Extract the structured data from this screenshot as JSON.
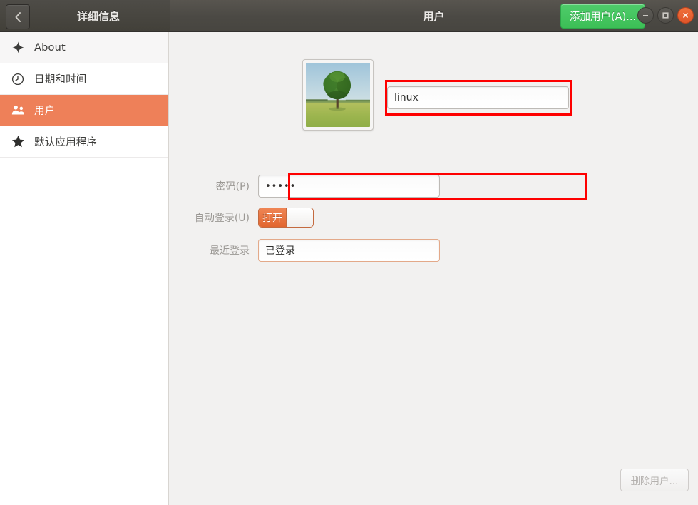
{
  "titlebar": {
    "back_icon": "chevron-left-icon",
    "left_title": "详细信息",
    "main_title": "用户",
    "add_user_label": "添加用户(A)...",
    "minimize_icon": "minimize-icon",
    "maximize_icon": "maximize-icon",
    "close_icon": "close-icon",
    "bar_color": "#4b4944",
    "add_button_color": "#3cbf56",
    "close_button_color": "#e0562a"
  },
  "sidebar": {
    "items": [
      {
        "label": "About",
        "icon": "sparkle-icon",
        "selected": false
      },
      {
        "label": "日期和时间",
        "icon": "clock-icon",
        "selected": false
      },
      {
        "label": "用户",
        "icon": "users-icon",
        "selected": true
      },
      {
        "label": "默认应用程序",
        "icon": "star-icon",
        "selected": false
      }
    ],
    "selected_color": "#ee8059"
  },
  "main": {
    "avatar_alt": "tree-photo-avatar",
    "name_value": "linux",
    "fields": [
      {
        "label": "密码(P)",
        "value": "•••••",
        "type": "password"
      },
      {
        "label": "自动登录(U)",
        "value": "打开",
        "type": "switch"
      },
      {
        "label": "最近登录",
        "value": "已登录",
        "type": "text"
      }
    ],
    "remove_user_label": "删除用户..."
  },
  "annotations": {
    "color": "#fe0000",
    "boxes": [
      "name-input-highlight",
      "auto-login-row-highlight"
    ]
  }
}
